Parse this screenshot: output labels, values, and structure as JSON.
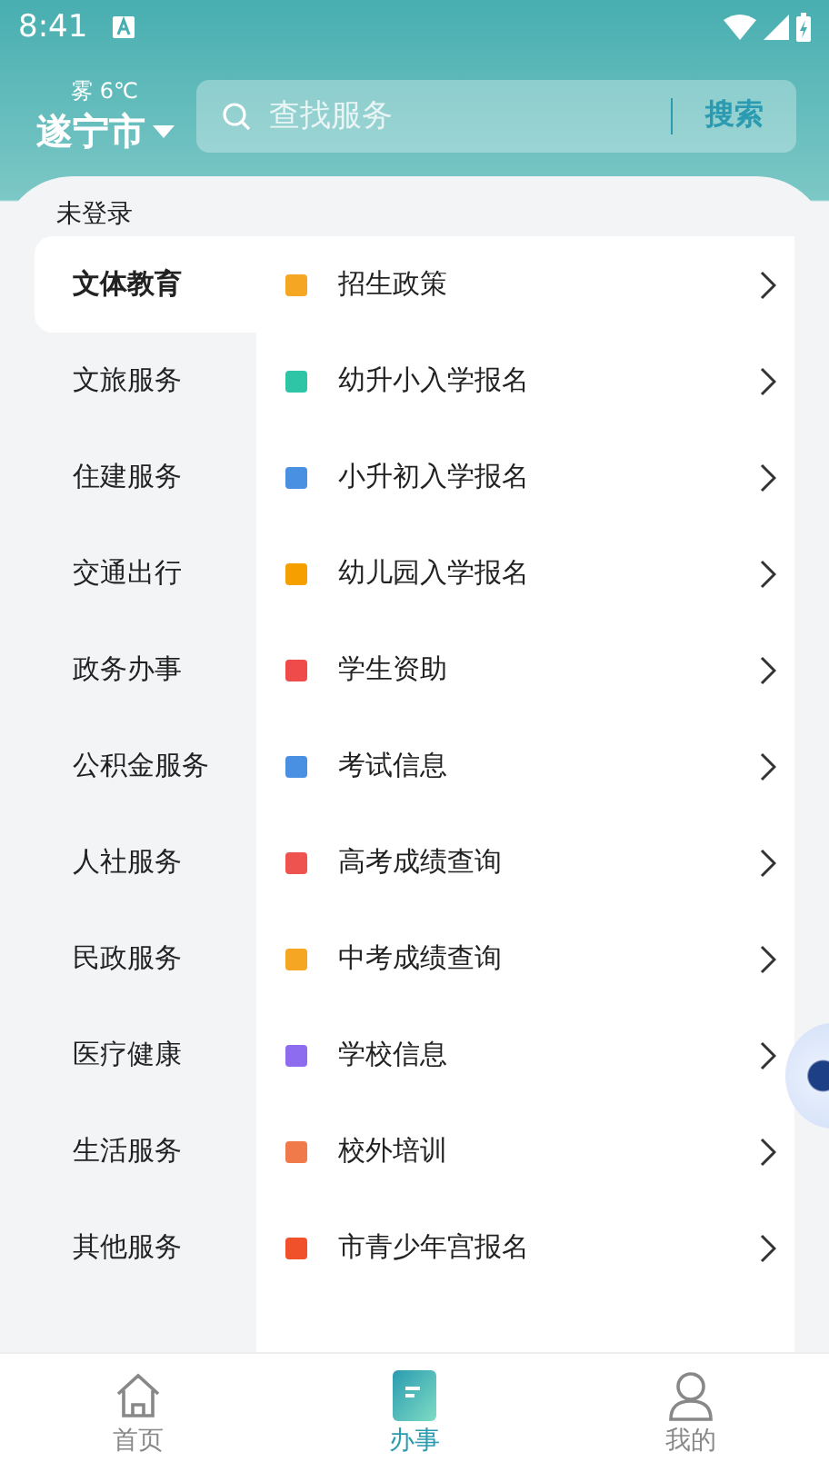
{
  "status_bar": {
    "time": "8:41"
  },
  "header": {
    "weather": "雾 6℃",
    "city": "遂宁市",
    "search": {
      "placeholder": "查找服务",
      "button": "搜索"
    }
  },
  "login_status": "未登录",
  "categories": [
    {
      "label": "文体教育",
      "selected": true
    },
    {
      "label": "文旅服务",
      "selected": false
    },
    {
      "label": "住建服务",
      "selected": false
    },
    {
      "label": "交通出行",
      "selected": false
    },
    {
      "label": "政务办事",
      "selected": false
    },
    {
      "label": "公积金服务",
      "selected": false
    },
    {
      "label": "人社服务",
      "selected": false
    },
    {
      "label": "民政服务",
      "selected": false
    },
    {
      "label": "医疗健康",
      "selected": false
    },
    {
      "label": "生活服务",
      "selected": false
    },
    {
      "label": "其他服务",
      "selected": false
    }
  ],
  "services": [
    {
      "label": "招生政策",
      "color": "#f5a623"
    },
    {
      "label": "幼升小入学报名",
      "color": "#2ec4a6"
    },
    {
      "label": "小升初入学报名",
      "color": "#4a90e2"
    },
    {
      "label": "幼儿园入学报名",
      "color": "#f5a000"
    },
    {
      "label": "学生资助",
      "color": "#ef4b4b"
    },
    {
      "label": "考试信息",
      "color": "#4a90e2"
    },
    {
      "label": "高考成绩查询",
      "color": "#ef5350"
    },
    {
      "label": "中考成绩查询",
      "color": "#f5a623"
    },
    {
      "label": "学校信息",
      "color": "#8e6cf0"
    },
    {
      "label": "校外培训",
      "color": "#f07a4a"
    },
    {
      "label": "市青少年宫报名",
      "color": "#f0502a"
    }
  ],
  "tabs": [
    {
      "label": "首页",
      "kind": "home",
      "selected": false
    },
    {
      "label": "办事",
      "kind": "book",
      "selected": true
    },
    {
      "label": "我的",
      "kind": "person",
      "selected": false
    }
  ]
}
